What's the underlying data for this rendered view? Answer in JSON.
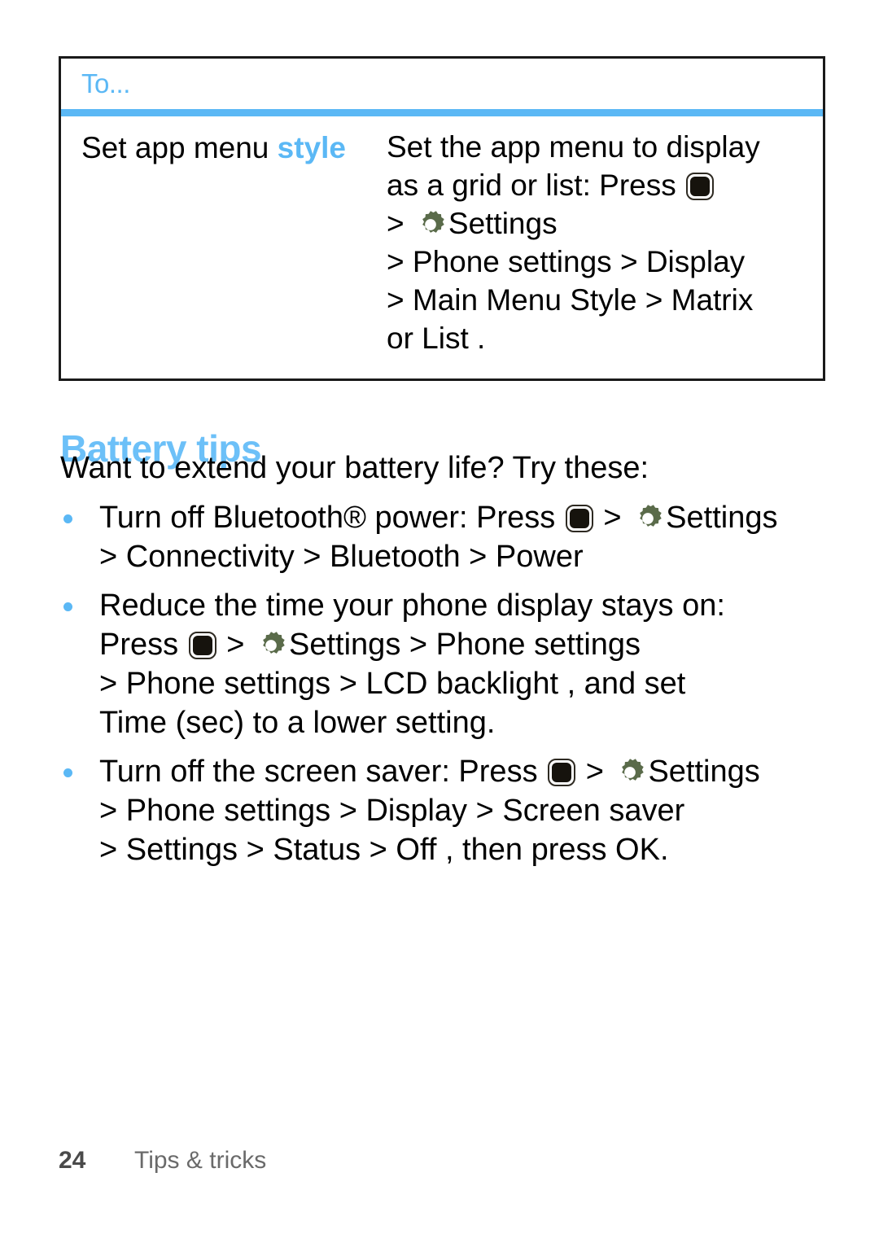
{
  "colors": {
    "accent_blue": "#5BB8F5",
    "heading_blue": "#6CC0F8",
    "gear_green": "#5A6B4A",
    "key_dark": "#16130d",
    "border_black": "#1a1a1a",
    "footer_gray": "#6a6a6a"
  },
  "table": {
    "header_label": "To...",
    "row": {
      "task": {
        "prefix": "Set app menu ",
        "keyword": "style"
      },
      "steps_lines": [
        "Set the app menu to display",
        "as a grid or list: Press ",
        "> ",
        "> Phone settings   > Display",
        "> Main Menu Style   > Matrix",
        "or List ."
      ],
      "line2_suffix": "",
      "line3_label": "Settings"
    }
  },
  "section": {
    "heading": "Battery tips",
    "intro": "Want to extend your battery life? Try these:"
  },
  "bullets": [
    {
      "line1_a": "Turn off Bluetooth® power: Press ",
      "line1_b": " > ",
      "line1_c": "Settings",
      "line2": "> Connectivity   > Bluetooth   > Power"
    },
    {
      "line1": "Reduce the time your phone display stays on:",
      "line2_a": "Press ",
      "line2_b": " > ",
      "line2_c": "Settings  > Phone settings",
      "line3": "> Phone settings   > LCD backlight , and set",
      "line4": "Time (sec) to a lower setting."
    },
    {
      "line1_a": "Turn off the screen saver: Press ",
      "line1_b": " > ",
      "line1_c": "Settings",
      "line2": "> Phone settings   > Display  > Screen saver",
      "line3": "> Settings   > Status  > Off , then press OK."
    }
  ],
  "icons": {
    "center_key": "center-key-icon",
    "gear": "settings-gear-icon",
    "bullet": "bullet-dot-icon"
  },
  "footer": {
    "page_number": "24",
    "title": "Tips & tricks"
  }
}
